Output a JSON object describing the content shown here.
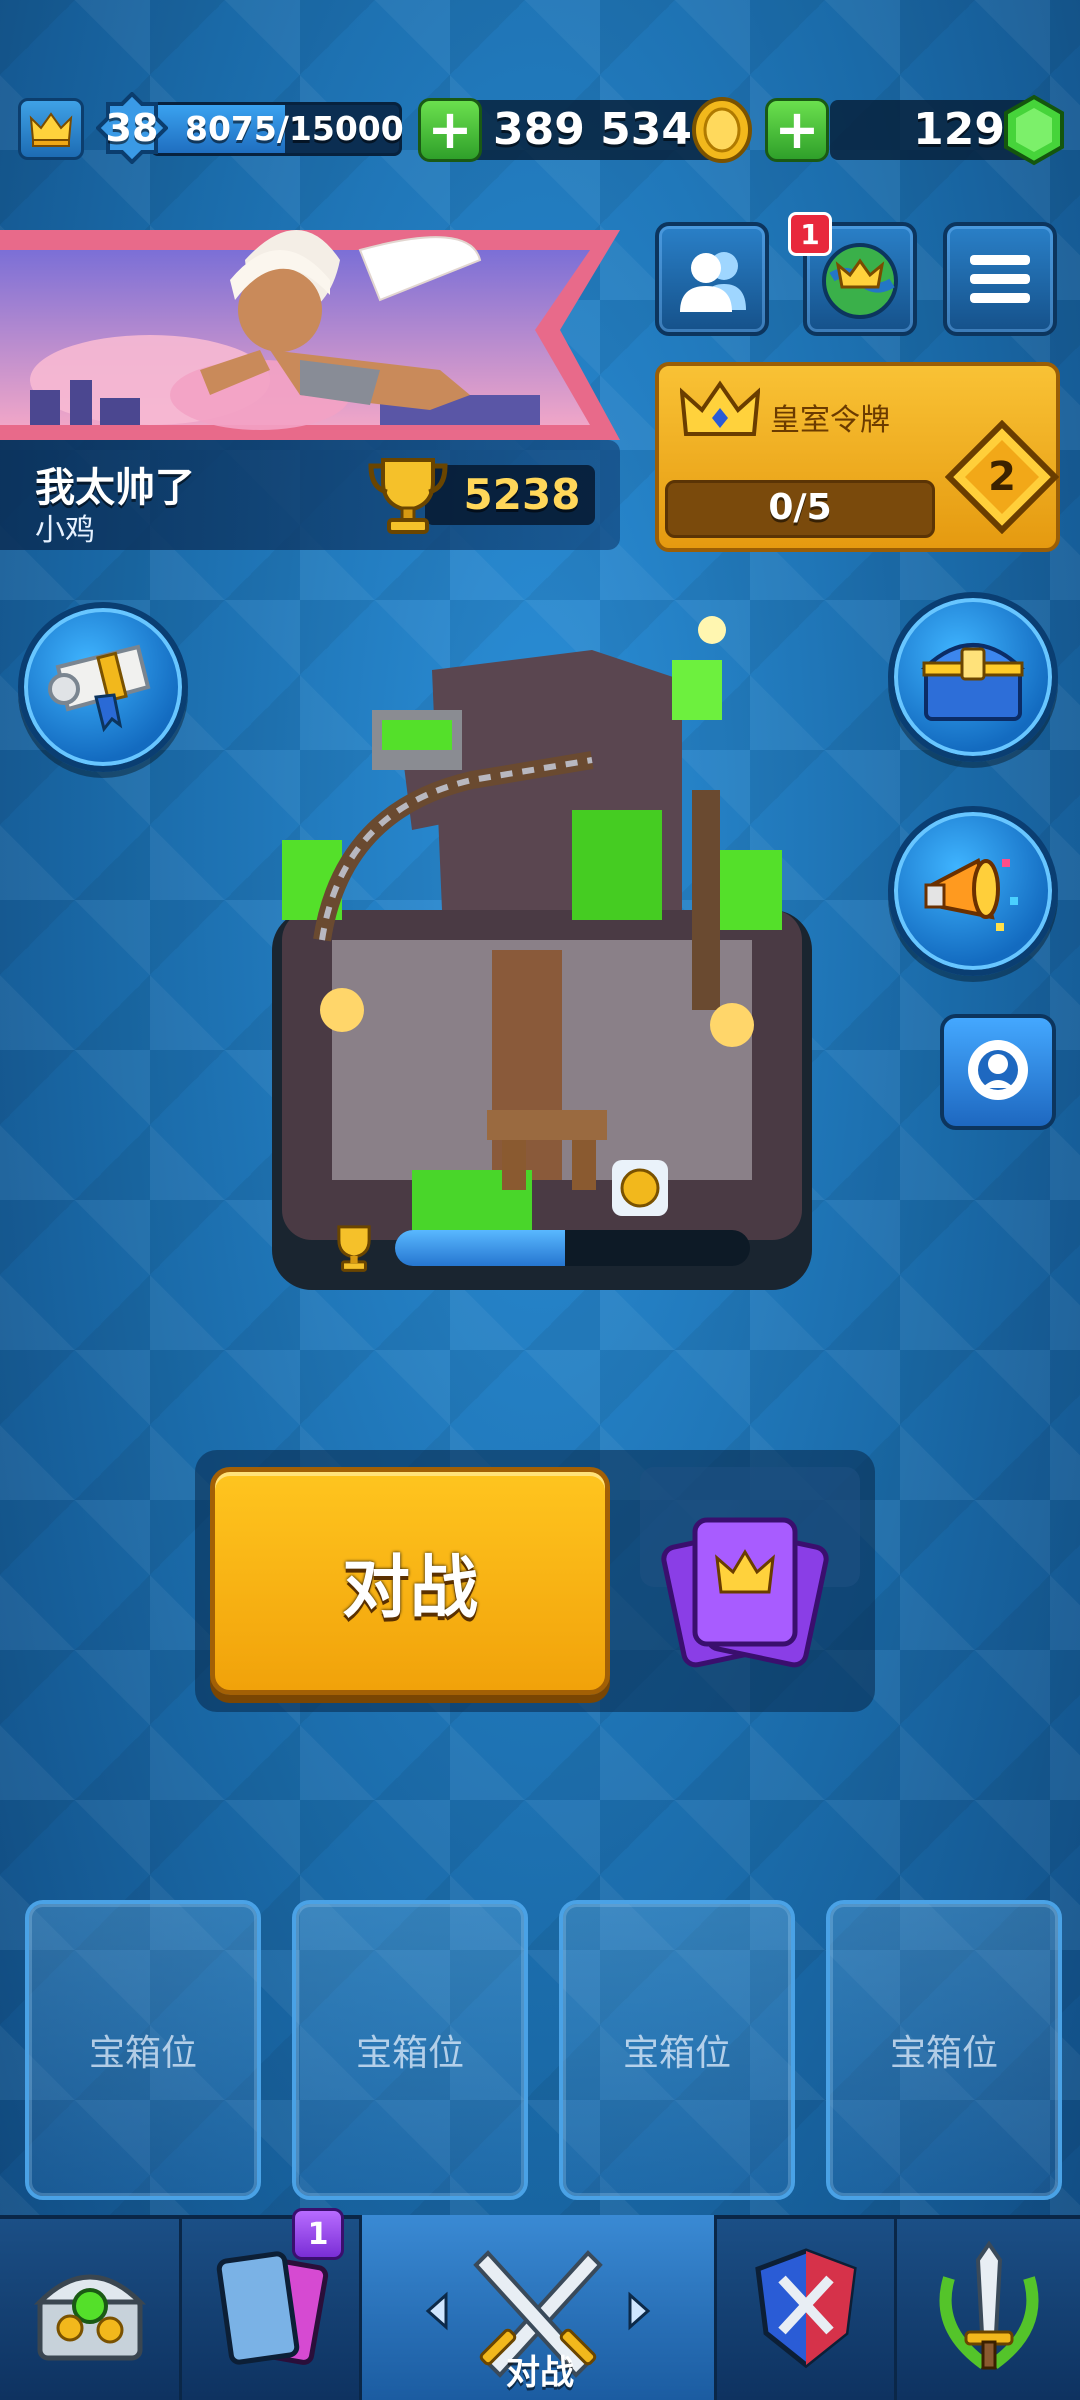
{
  "header": {
    "level": "38",
    "xp": "8075/15000",
    "xp_fraction": 0.538,
    "gold": "389 534",
    "gems": "129"
  },
  "profile": {
    "player_name": "我太帅了",
    "clan_name": "小鸡",
    "trophies": "5238"
  },
  "social": {
    "friends_icon": "friends-icon",
    "clan_notification": "1",
    "menu_icon": "menu-icon"
  },
  "royal_pass": {
    "title": "皇室令牌",
    "progress": "0/5",
    "tier": "2"
  },
  "arena": {
    "trophy_road_progress": 0.48
  },
  "battle": {
    "label": "对战"
  },
  "chest_slots": [
    {
      "label": "宝箱位"
    },
    {
      "label": "宝箱位"
    },
    {
      "label": "宝箱位"
    },
    {
      "label": "宝箱位"
    }
  ],
  "bottom_nav": {
    "shop_icon": "chest-shop-icon",
    "cards_badge": "1",
    "battle_label": "对战",
    "clan_icon": "clan-shield-icon",
    "events_icon": "sword-wreath-icon"
  },
  "colors": {
    "background": "#1c6fae",
    "battle_button": "#ffc51f",
    "pass_gold": "#f9c235",
    "gem_green": "#46d43a"
  }
}
